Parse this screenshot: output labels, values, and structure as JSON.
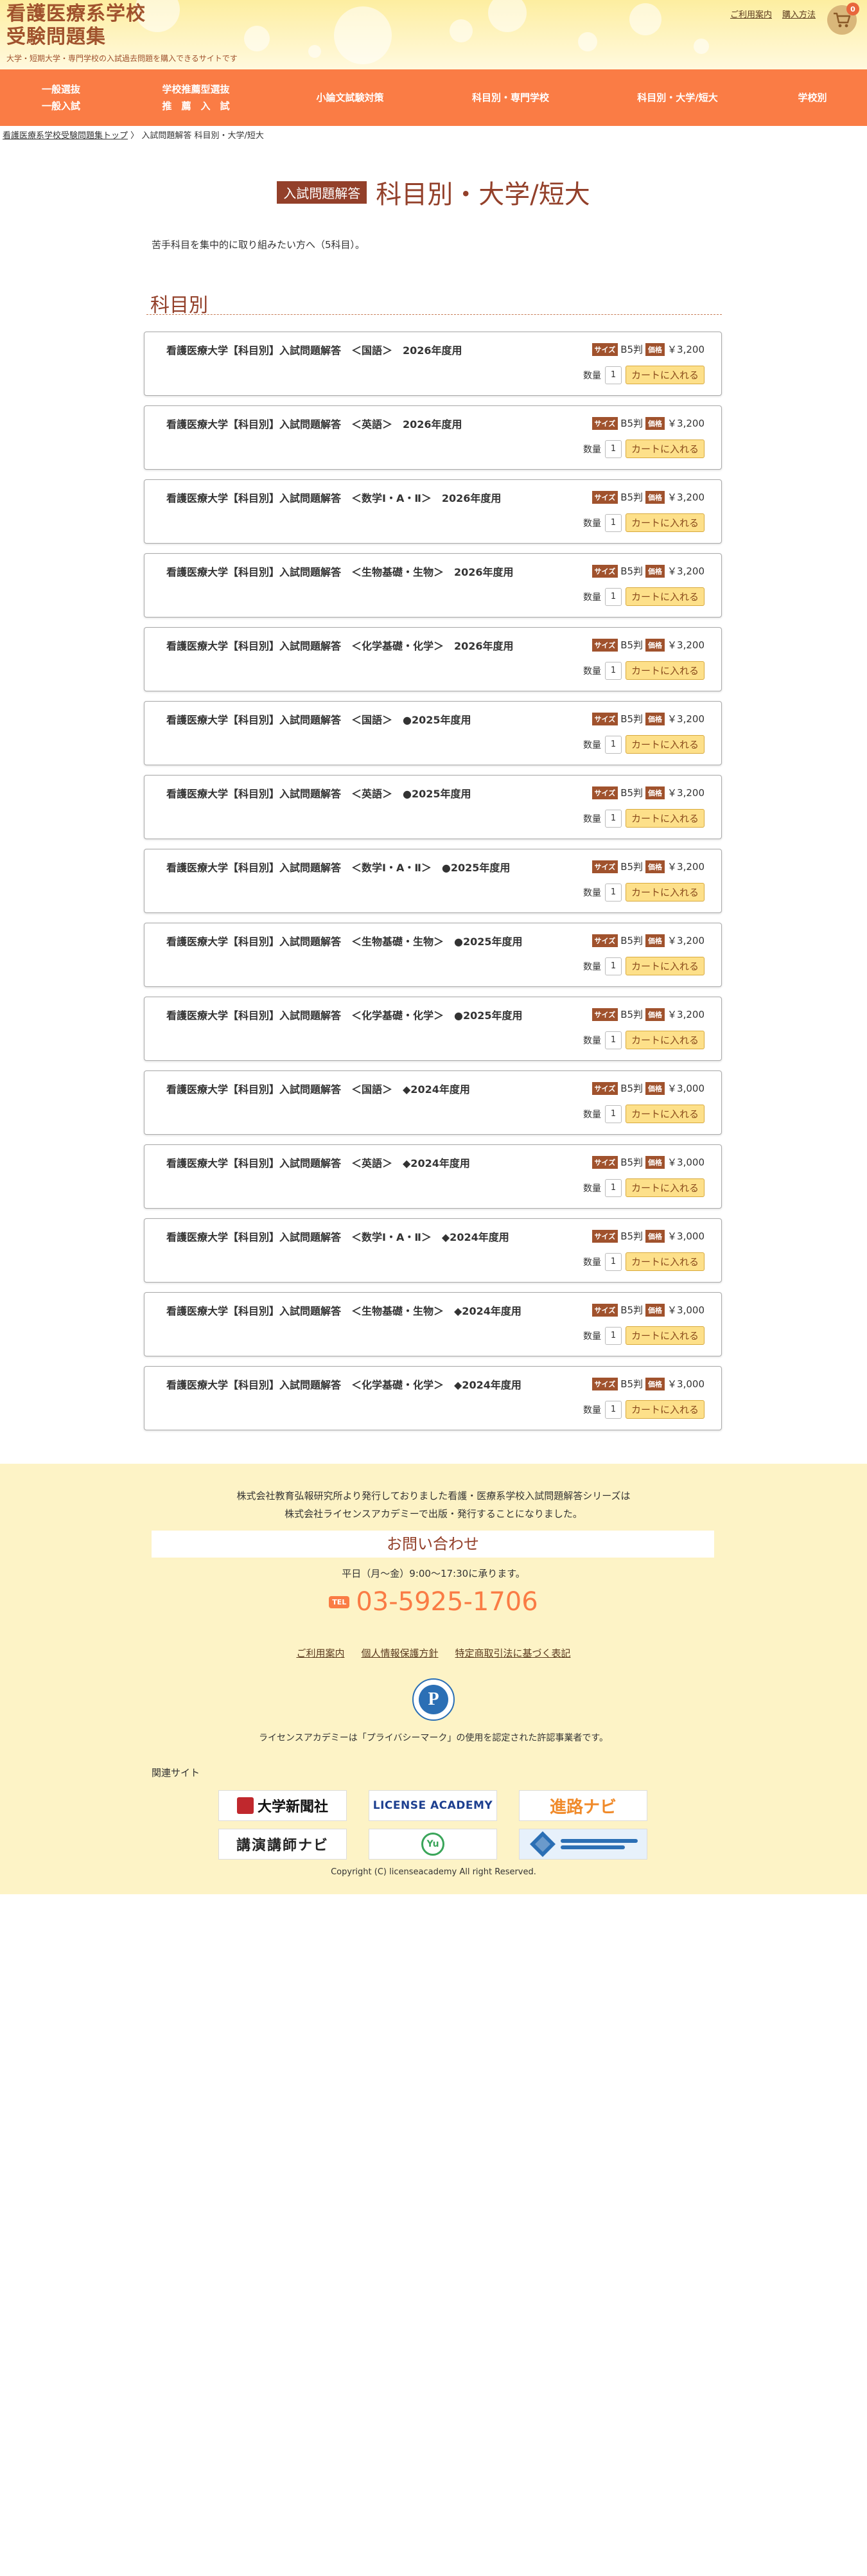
{
  "header": {
    "site_title_line1": "看護医療系学校",
    "site_title_line2": "受験問題集",
    "tagline": "大学・短期大学・専門学校の入試過去問題を購入できるサイトです",
    "link_guide": "ご利用案内",
    "link_purchase": "購入方法",
    "cart_count": "0"
  },
  "nav": {
    "item1_line1": "一般選抜",
    "item1_line2": "一般入試",
    "item2_line1": "学校推薦型選抜",
    "item2_line2": "推　薦　入　試",
    "item3": "小論文試験対策",
    "item4": "科目別・専門学校",
    "item5": "科目別・大学/短大",
    "item6": "学校別"
  },
  "breadcrumb": {
    "home": "看護医療系学校受験問題集トップ",
    "separator": "〉",
    "current": "入試問題解答 科目別・大学/短大"
  },
  "page": {
    "badge": "入試問題解答",
    "title": "科目別・大学/短大",
    "intro": "苦手科目を集中的に取り組みたい方へ（5科目）。",
    "section_title": "科目別"
  },
  "labels": {
    "size_tag": "サイズ",
    "price_tag": "価格",
    "qty_label": "数量",
    "add_to_cart": "カートに入れる"
  },
  "products": [
    {
      "name": "看護医療大学【科目別】入試問題解答　＜国語＞　2026年度用",
      "size": "B5判",
      "price": "￥3,200",
      "qty": "1"
    },
    {
      "name": "看護医療大学【科目別】入試問題解答　＜英語＞　2026年度用",
      "size": "B5判",
      "price": "￥3,200",
      "qty": "1"
    },
    {
      "name": "看護医療大学【科目別】入試問題解答　＜数学Ⅰ・A・Ⅱ＞　2026年度用",
      "size": "B5判",
      "price": "￥3,200",
      "qty": "1"
    },
    {
      "name": "看護医療大学【科目別】入試問題解答　＜生物基礎・生物＞　2026年度用",
      "size": "B5判",
      "price": "￥3,200",
      "qty": "1"
    },
    {
      "name": "看護医療大学【科目別】入試問題解答　＜化学基礎・化学＞　2026年度用",
      "size": "B5判",
      "price": "￥3,200",
      "qty": "1"
    },
    {
      "name": "看護医療大学【科目別】入試問題解答　＜国語＞　●2025年度用",
      "size": "B5判",
      "price": "￥3,200",
      "qty": "1"
    },
    {
      "name": "看護医療大学【科目別】入試問題解答　＜英語＞　●2025年度用",
      "size": "B5判",
      "price": "￥3,200",
      "qty": "1"
    },
    {
      "name": "看護医療大学【科目別】入試問題解答　＜数学Ⅰ・A・Ⅱ＞　●2025年度用",
      "size": "B5判",
      "price": "￥3,200",
      "qty": "1"
    },
    {
      "name": "看護医療大学【科目別】入試問題解答　＜生物基礎・生物＞　●2025年度用",
      "size": "B5判",
      "price": "￥3,200",
      "qty": "1"
    },
    {
      "name": "看護医療大学【科目別】入試問題解答　＜化学基礎・化学＞　●2025年度用",
      "size": "B5判",
      "price": "￥3,200",
      "qty": "1"
    },
    {
      "name": "看護医療大学【科目別】入試問題解答　＜国語＞　◆2024年度用",
      "size": "B5判",
      "price": "￥3,000",
      "qty": "1"
    },
    {
      "name": "看護医療大学【科目別】入試問題解答　＜英語＞　◆2024年度用",
      "size": "B5判",
      "price": "￥3,000",
      "qty": "1"
    },
    {
      "name": "看護医療大学【科目別】入試問題解答　＜数学Ⅰ・A・Ⅱ＞　◆2024年度用",
      "size": "B5判",
      "price": "￥3,000",
      "qty": "1"
    },
    {
      "name": "看護医療大学【科目別】入試問題解答　＜生物基礎・生物＞　◆2024年度用",
      "size": "B5判",
      "price": "￥3,000",
      "qty": "1"
    },
    {
      "name": "看護医療大学【科目別】入試問題解答　＜化学基礎・化学＞　◆2024年度用",
      "size": "B5判",
      "price": "￥3,000",
      "qty": "1"
    }
  ],
  "footer": {
    "notice_line1": "株式会社教育弘報研究所より発行しておりました看護・医療系学校入試問題解答シリーズは",
    "notice_line2": "株式会社ライセンスアカデミーで出版・発行することになりました。",
    "contact_title": "お問い合わせ",
    "hours": "平日（月〜金）9:00〜17:30に承ります。",
    "tel_badge": "TEL",
    "tel": "03-5925-1706",
    "link_guide": "ご利用案内",
    "link_privacy": "個人情報保護方針",
    "link_tokushoho": "特定商取引法に基づく表記",
    "pmark_caption": "ライセンスアカデミーは「プライバシーマーク」の使用を認定された許認事業者です。",
    "related_title": "関連サイト",
    "banner_daigaku": "大学新聞社",
    "banner_license": "LICENSE ACADEMY",
    "banner_shinro": "進路ナビ",
    "banner_koen": "講演講師ナビ",
    "banner_yu": "Yu",
    "copyright": "Copyright (C) licenseacademy All right Reserved."
  },
  "colors": {
    "accent": "#fa7c45",
    "brown": "#93402a",
    "footer_bg": "#fdf3c6",
    "header_bg": "#fdeea0"
  }
}
